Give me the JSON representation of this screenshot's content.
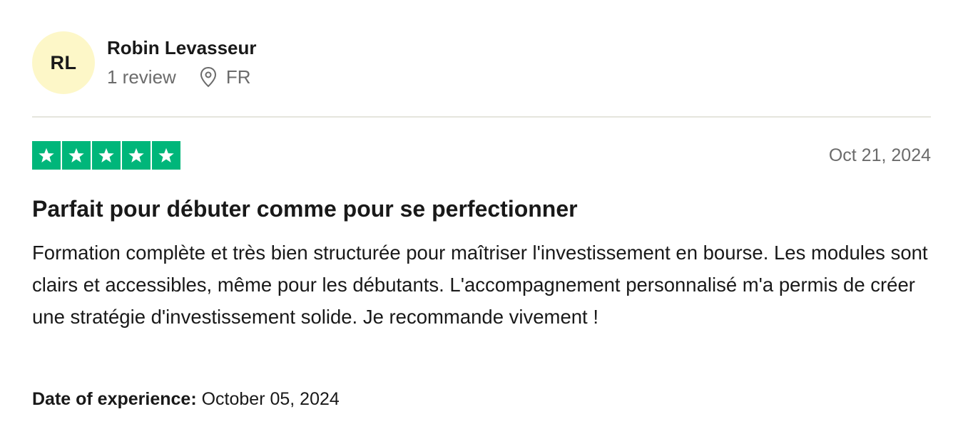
{
  "consumer": {
    "initials": "RL",
    "name": "Robin Levasseur",
    "review_count": "1 review",
    "location_icon": "location-pin-icon",
    "country": "FR",
    "avatar_color": "#fdf7c8"
  },
  "review": {
    "rating": 5,
    "rating_max": 5,
    "star_icon": "star-icon",
    "star_color": "#00b67a",
    "date": "Oct 21, 2024",
    "title": "Parfait pour débuter comme pour se perfectionner",
    "body": "Formation complète et très bien structurée pour maîtriser l'investissement en bourse. Les modules sont clairs et accessibles, même pour les débutants. L'accompagnement personnalisé m'a permis de créer une stratégie d'investissement solide. Je recommande vivement !",
    "experience_label": "Date of experience:",
    "experience_date": "October 05, 2024"
  }
}
